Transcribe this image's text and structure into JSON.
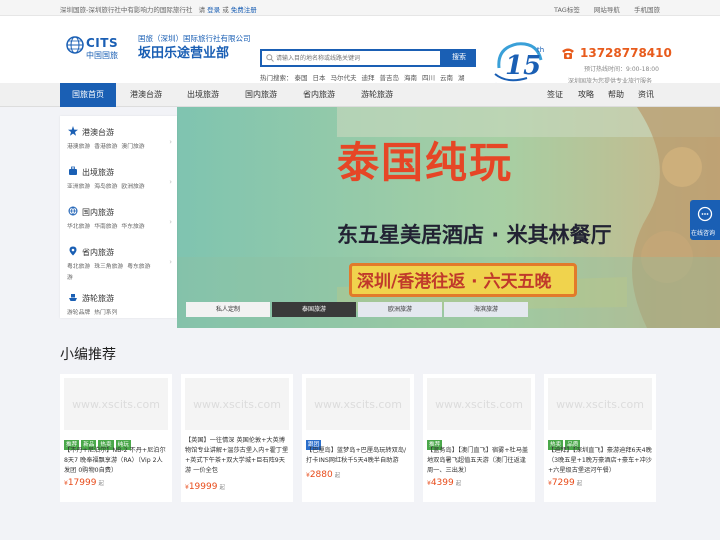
{
  "topbar": {
    "slogan": "深圳国旅-深圳旅行社中有影响力的国际旅行社",
    "please": "请",
    "login": "登录",
    "or": "或",
    "register": "免费注册",
    "links": [
      "TAG标签",
      "网站导航",
      "手机国旅"
    ]
  },
  "header": {
    "logo_en": "CITS",
    "logo_cn": "中国国旅",
    "company": "国旅（深圳）国际旅行社有限公司",
    "branch": "坂田乐途营业部",
    "search_placeholder": "请输入目的地名称或线路关键词",
    "search_button": "搜索",
    "hot_label": "热门搜索：",
    "hot_terms": [
      "泰国",
      "日本",
      "马尔代夫",
      "迪拜",
      "普吉岛",
      "海南",
      "四川",
      "云南",
      "湖南",
      "河源"
    ],
    "anniv_sub": "国旅深圳15周年 2009-2024",
    "phone": "13728778410",
    "hours": "预订热线时间：9:00-18:00",
    "service": "深圳国旅为您提供专业旅行服务"
  },
  "nav": {
    "items": [
      "国旅首页",
      "港澳台游",
      "出境旅游",
      "国内旅游",
      "省内旅游",
      "游轮旅游"
    ],
    "right_items": [
      "签证",
      "攻略",
      "帮助",
      "资讯"
    ]
  },
  "categories": [
    {
      "title": "港澳台游",
      "subs": [
        "港澳旅游",
        "香港旅游",
        "澳门旅游"
      ]
    },
    {
      "title": "出境旅游",
      "subs": [
        "亚洲旅游",
        "海岛旅游",
        "欧洲旅游"
      ]
    },
    {
      "title": "国内旅游",
      "subs": [
        "华北旅游",
        "华南旅游",
        "华东旅游"
      ]
    },
    {
      "title": "省内旅游",
      "subs": [
        "粤北旅游",
        "珠三角旅游",
        "粤东旅游",
        "游"
      ]
    },
    {
      "title": "游轮旅游",
      "subs": [
        "游轮品牌",
        "热门系列"
      ]
    }
  ],
  "banner": {
    "headline": "泰国纯玩",
    "line2": "东五星美居酒店 · 米其林餐厅",
    "line3": "深圳/香港往返 · 六天五晚"
  },
  "banner_tabs": [
    "私人定制",
    "泰国旅游",
    "欧洲旅游",
    "海滨旅游"
  ],
  "online_service": "在线咨询",
  "section_title": "小编推荐",
  "watermark": "www.xscits.com",
  "cards": [
    {
      "tags": [
        {
          "t": "推荐",
          "c": "green"
        },
        {
          "t": "新品",
          "c": "green"
        },
        {
          "t": "热卖",
          "c": "green"
        },
        {
          "t": "纯玩",
          "c": "green"
        }
      ],
      "desc": "【不丹+尼泊尔】NB-2 不丹+尼泊尔8天7 晚奉福飘享游（RA）（Vip 2人发团 0购物0自费）",
      "price": "17999"
    },
    {
      "tags": [],
      "desc": "【英国】一往情深 英国伦敦+大英博物馆专业讲解+温莎古堡入内+霍丁堡+英式下午茶+双大学城+巨石阵9天游 一价全包",
      "price": "19999"
    },
    {
      "tags": [
        {
          "t": "跟团",
          "c": "blue"
        }
      ],
      "desc": "【巴厘岛】蓝梦岛+巴厘岛玩转双岛/打卡INS网红秋千5天4晚半自助游",
      "price": "2880"
    },
    {
      "tags": [
        {
          "t": "推荐",
          "c": "green"
        }
      ],
      "desc": "【蓝务岛】【澳门直飞】宿雾+杜马盖地双岛暑飞超值五天游（澳门往返逢周一、三出发）",
      "price": "4399"
    },
    {
      "tags": [
        {
          "t": "热卖",
          "c": "green"
        },
        {
          "t": "品质",
          "c": "green"
        }
      ],
      "desc": "【迪拜】【深圳直飞】豪游迪拜6天4晚（3晚五星+1晚万豪酒店+豪车+冲沙+六星级古堡运河午餐）",
      "price": "7299"
    }
  ],
  "price_prefix": "¥",
  "price_suffix": "起",
  "colors": {
    "brand": "#1a5fb4",
    "accent": "#e84c1b",
    "phone": "#e85b1c"
  }
}
